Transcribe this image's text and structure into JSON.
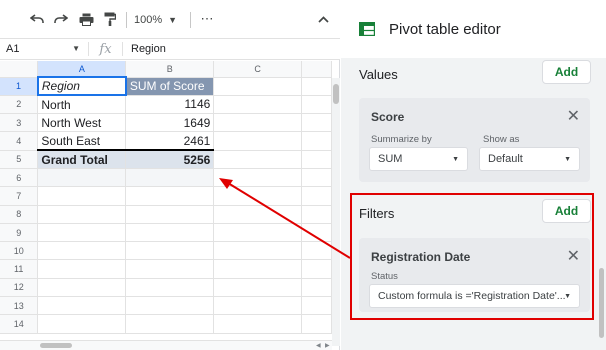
{
  "toolbar": {
    "zoom": "100%",
    "more": "⋯"
  },
  "formula_bar": {
    "cell_ref": "A1",
    "fx": "fx",
    "value": "Region"
  },
  "grid": {
    "columns": [
      "A",
      "B",
      "C"
    ],
    "rows": [
      "1",
      "2",
      "3",
      "4",
      "5",
      "6",
      "7",
      "8",
      "9",
      "10",
      "11",
      "12",
      "13",
      "14"
    ],
    "header": {
      "region": "Region",
      "score": "SUM of Score"
    },
    "data": [
      {
        "region": "North",
        "score": "1146"
      },
      {
        "region": "North West",
        "score": "1649"
      },
      {
        "region": "South East",
        "score": "2461"
      }
    ],
    "total": {
      "label": "Grand Total",
      "score": "5256"
    }
  },
  "editor": {
    "title": "Pivot table editor",
    "values": {
      "title": "Values",
      "add_label": "Add",
      "card": {
        "title": "Score",
        "summarize_label": "Summarize by",
        "summarize_value": "SUM",
        "show_as_label": "Show as",
        "show_as_value": "Default"
      }
    },
    "filters": {
      "title": "Filters",
      "add_label": "Add",
      "card": {
        "title": "Registration Date",
        "status_label": "Status",
        "status_value": "Custom formula is ='Registration Date'..."
      }
    }
  },
  "colors": {
    "accent_green": "#188038",
    "highlight_red": "#e00000",
    "pivot_header": "#8496b0",
    "selection_blue": "#1a73e8"
  }
}
